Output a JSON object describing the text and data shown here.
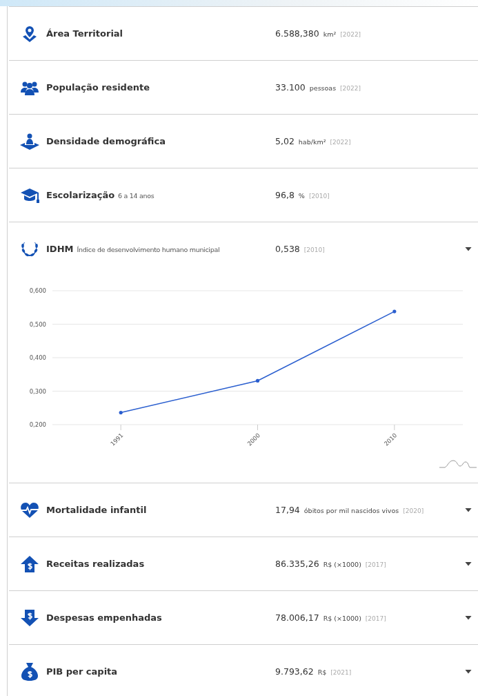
{
  "indicators": [
    {
      "kind": "pin",
      "label": "Área Territorial",
      "value": "6.588,380",
      "unit": "km²",
      "year": "[2022]",
      "expandable": false
    },
    {
      "kind": "people",
      "label": "População residente",
      "value": "33.100",
      "unit": "pessoas",
      "year": "[2022]",
      "expandable": false
    },
    {
      "kind": "person-map",
      "label": "Densidade demográfica",
      "value": "5,02",
      "unit": "hab/km²",
      "year": "[2022]",
      "expandable": false
    },
    {
      "kind": "cap",
      "label": "Escolarização",
      "sublabel": "6 a 14 anos",
      "value": "96,8",
      "unit": "%",
      "year": "[2010]",
      "expandable": false
    },
    {
      "kind": "laurel",
      "label": "IDHM",
      "sublabel": "Índice de desenvolvimento humano municipal",
      "value": "0,538",
      "year": "[2010]",
      "expandable": true,
      "chart_data": {
        "type": "line",
        "grid": true,
        "categories": [
          "1991",
          "2000",
          "2010"
        ],
        "ylim": [
          0.2,
          0.6
        ],
        "yticks": [
          {
            "value": 0.2,
            "label": "0,200"
          },
          {
            "value": 0.3,
            "label": "0,300"
          },
          {
            "value": 0.4,
            "label": "0,400"
          },
          {
            "value": 0.5,
            "label": "0,500"
          },
          {
            "value": 0.6,
            "label": "0,600"
          }
        ],
        "series": [
          {
            "color": "#2b5fcf",
            "values": [
              0.236,
              0.331,
              0.538
            ]
          }
        ]
      }
    },
    {
      "kind": "heart",
      "label": "Mortalidade infantil",
      "value": "17,94",
      "unit": "óbitos por mil nascidos vivos",
      "year": "[2020]",
      "expandable": true
    },
    {
      "kind": "money-up",
      "label": "Receitas realizadas",
      "value": "86.335,26",
      "unit": "R$ (×1000)",
      "year": "[2017]",
      "expandable": true
    },
    {
      "kind": "money-down",
      "label": "Despesas empenhadas",
      "value": "78.006,17",
      "unit": "R$ (×1000)",
      "year": "[2017]",
      "expandable": true
    },
    {
      "kind": "bag",
      "label": "PIB per capita",
      "value": "9.793,62",
      "unit": "R$",
      "year": "[2021]",
      "expandable": true
    }
  ]
}
